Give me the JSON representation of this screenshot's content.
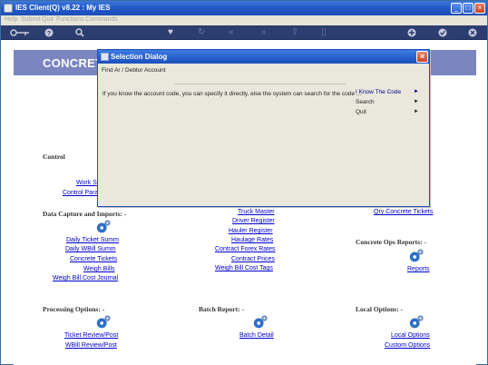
{
  "window": {
    "title": "IES Client(Q) v8.22 : My IES"
  },
  "menubar": [
    "Help",
    "Submit",
    "Quit",
    "Functions",
    "Commands"
  ],
  "toolbar": {
    "icons": [
      "key-icon",
      "help-icon",
      "search-icon",
      "heart-icon",
      "refresh-icon",
      "rewind-icon",
      "fast-forward-icon",
      "export-icon",
      "page-icon",
      "add-icon",
      "check-icon",
      "close-icon"
    ]
  },
  "page": {
    "title": "CONCRETE"
  },
  "sections": {
    "control": {
      "heading": "Control",
      "links": [
        "Work S",
        "Control Para"
      ]
    },
    "data_capture": {
      "heading": "Data Capture and Imports: -",
      "links": [
        "Daily Ticket Summ",
        "Daily WBill Summ",
        "Concrete Tickets",
        "Weigh Bills",
        "Weigh Bill Cost Journal"
      ]
    },
    "middle_links": [
      "Truck Master",
      "Driver Register",
      "Hauler Register",
      "Haulage Rates",
      "Contract Forex Rates",
      "Contract Prices",
      "Weigh Bill Cost Tags"
    ],
    "right_top_link": "Qry Concrete Tickets",
    "reports": {
      "heading": "Concrete Ops Reports: -",
      "links": [
        "Reports"
      ]
    },
    "processing": {
      "heading": "Processing Options: -",
      "links": [
        "Ticket Review/Post",
        "WBill Review/Post"
      ]
    },
    "batch": {
      "heading": "Batch Report: -",
      "links": [
        "Batch Detail"
      ]
    },
    "local": {
      "heading": "Local Options: -",
      "links": [
        "Local Options",
        "Custom Options"
      ]
    }
  },
  "dialog": {
    "title": "Selection Dialog",
    "subtitle": "Find Ar / Debtor Account",
    "message": "If you know the account code, you can specify it directly, else the system can search for the code ...",
    "options": [
      "I Know The Code",
      "Search",
      "Quit"
    ],
    "selected_option": "I Know The Code"
  },
  "colors": {
    "titlebar": "#2158c9",
    "toolbar": "#2c3d70",
    "header_band": "#7b86c0",
    "link": "#0000cc",
    "gear": "#2f6fc4"
  }
}
